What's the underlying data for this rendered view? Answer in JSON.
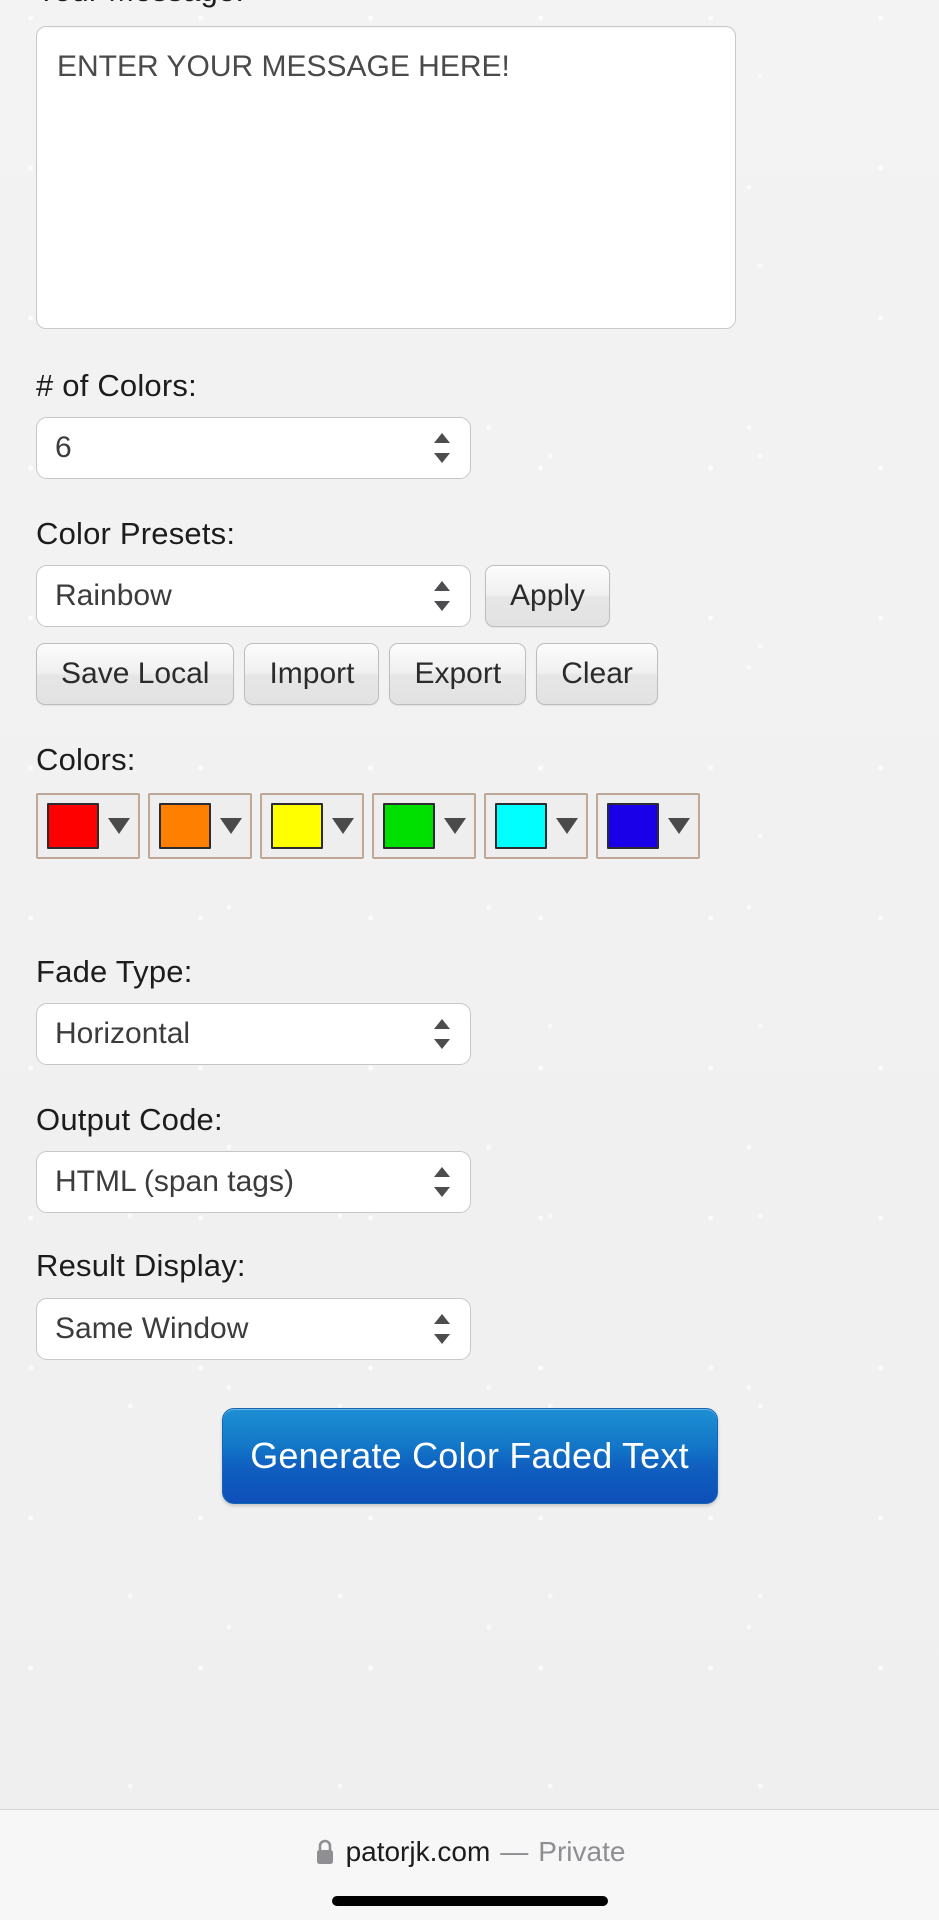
{
  "form": {
    "message_label": "Your Message:",
    "message_value": "ENTER YOUR MESSAGE HERE!",
    "num_colors_label": "# of Colors:",
    "num_colors_value": "6",
    "color_presets_label": "Color Presets:",
    "color_presets_value": "Rainbow",
    "apply_label": "Apply",
    "save_local_label": "Save Local",
    "import_label": "Import",
    "export_label": "Export",
    "clear_label": "Clear",
    "colors_label": "Colors:",
    "fade_type_label": "Fade Type:",
    "fade_type_value": "Horizontal",
    "output_code_label": "Output Code:",
    "output_code_value": "HTML (span tags)",
    "result_display_label": "Result Display:",
    "result_display_value": "Same Window",
    "generate_label": "Generate Color Faded Text"
  },
  "colors": [
    {
      "name": "red",
      "hex": "#FF0000"
    },
    {
      "name": "orange",
      "hex": "#FF8000"
    },
    {
      "name": "yellow",
      "hex": "#FFFF00"
    },
    {
      "name": "green",
      "hex": "#00E000"
    },
    {
      "name": "cyan",
      "hex": "#00FFFF"
    },
    {
      "name": "blue",
      "hex": "#1A00E8"
    }
  ],
  "browser": {
    "lock_icon": "lock-icon",
    "host": "patorjk.com",
    "separator": "—",
    "privacy_label": "Private"
  },
  "theme": {
    "accent": "#1378c8",
    "page_bg": "#f2f2f2",
    "text": "#1c1c1e",
    "muted": "#8e8e93",
    "swatch_border": "#c0a898"
  }
}
